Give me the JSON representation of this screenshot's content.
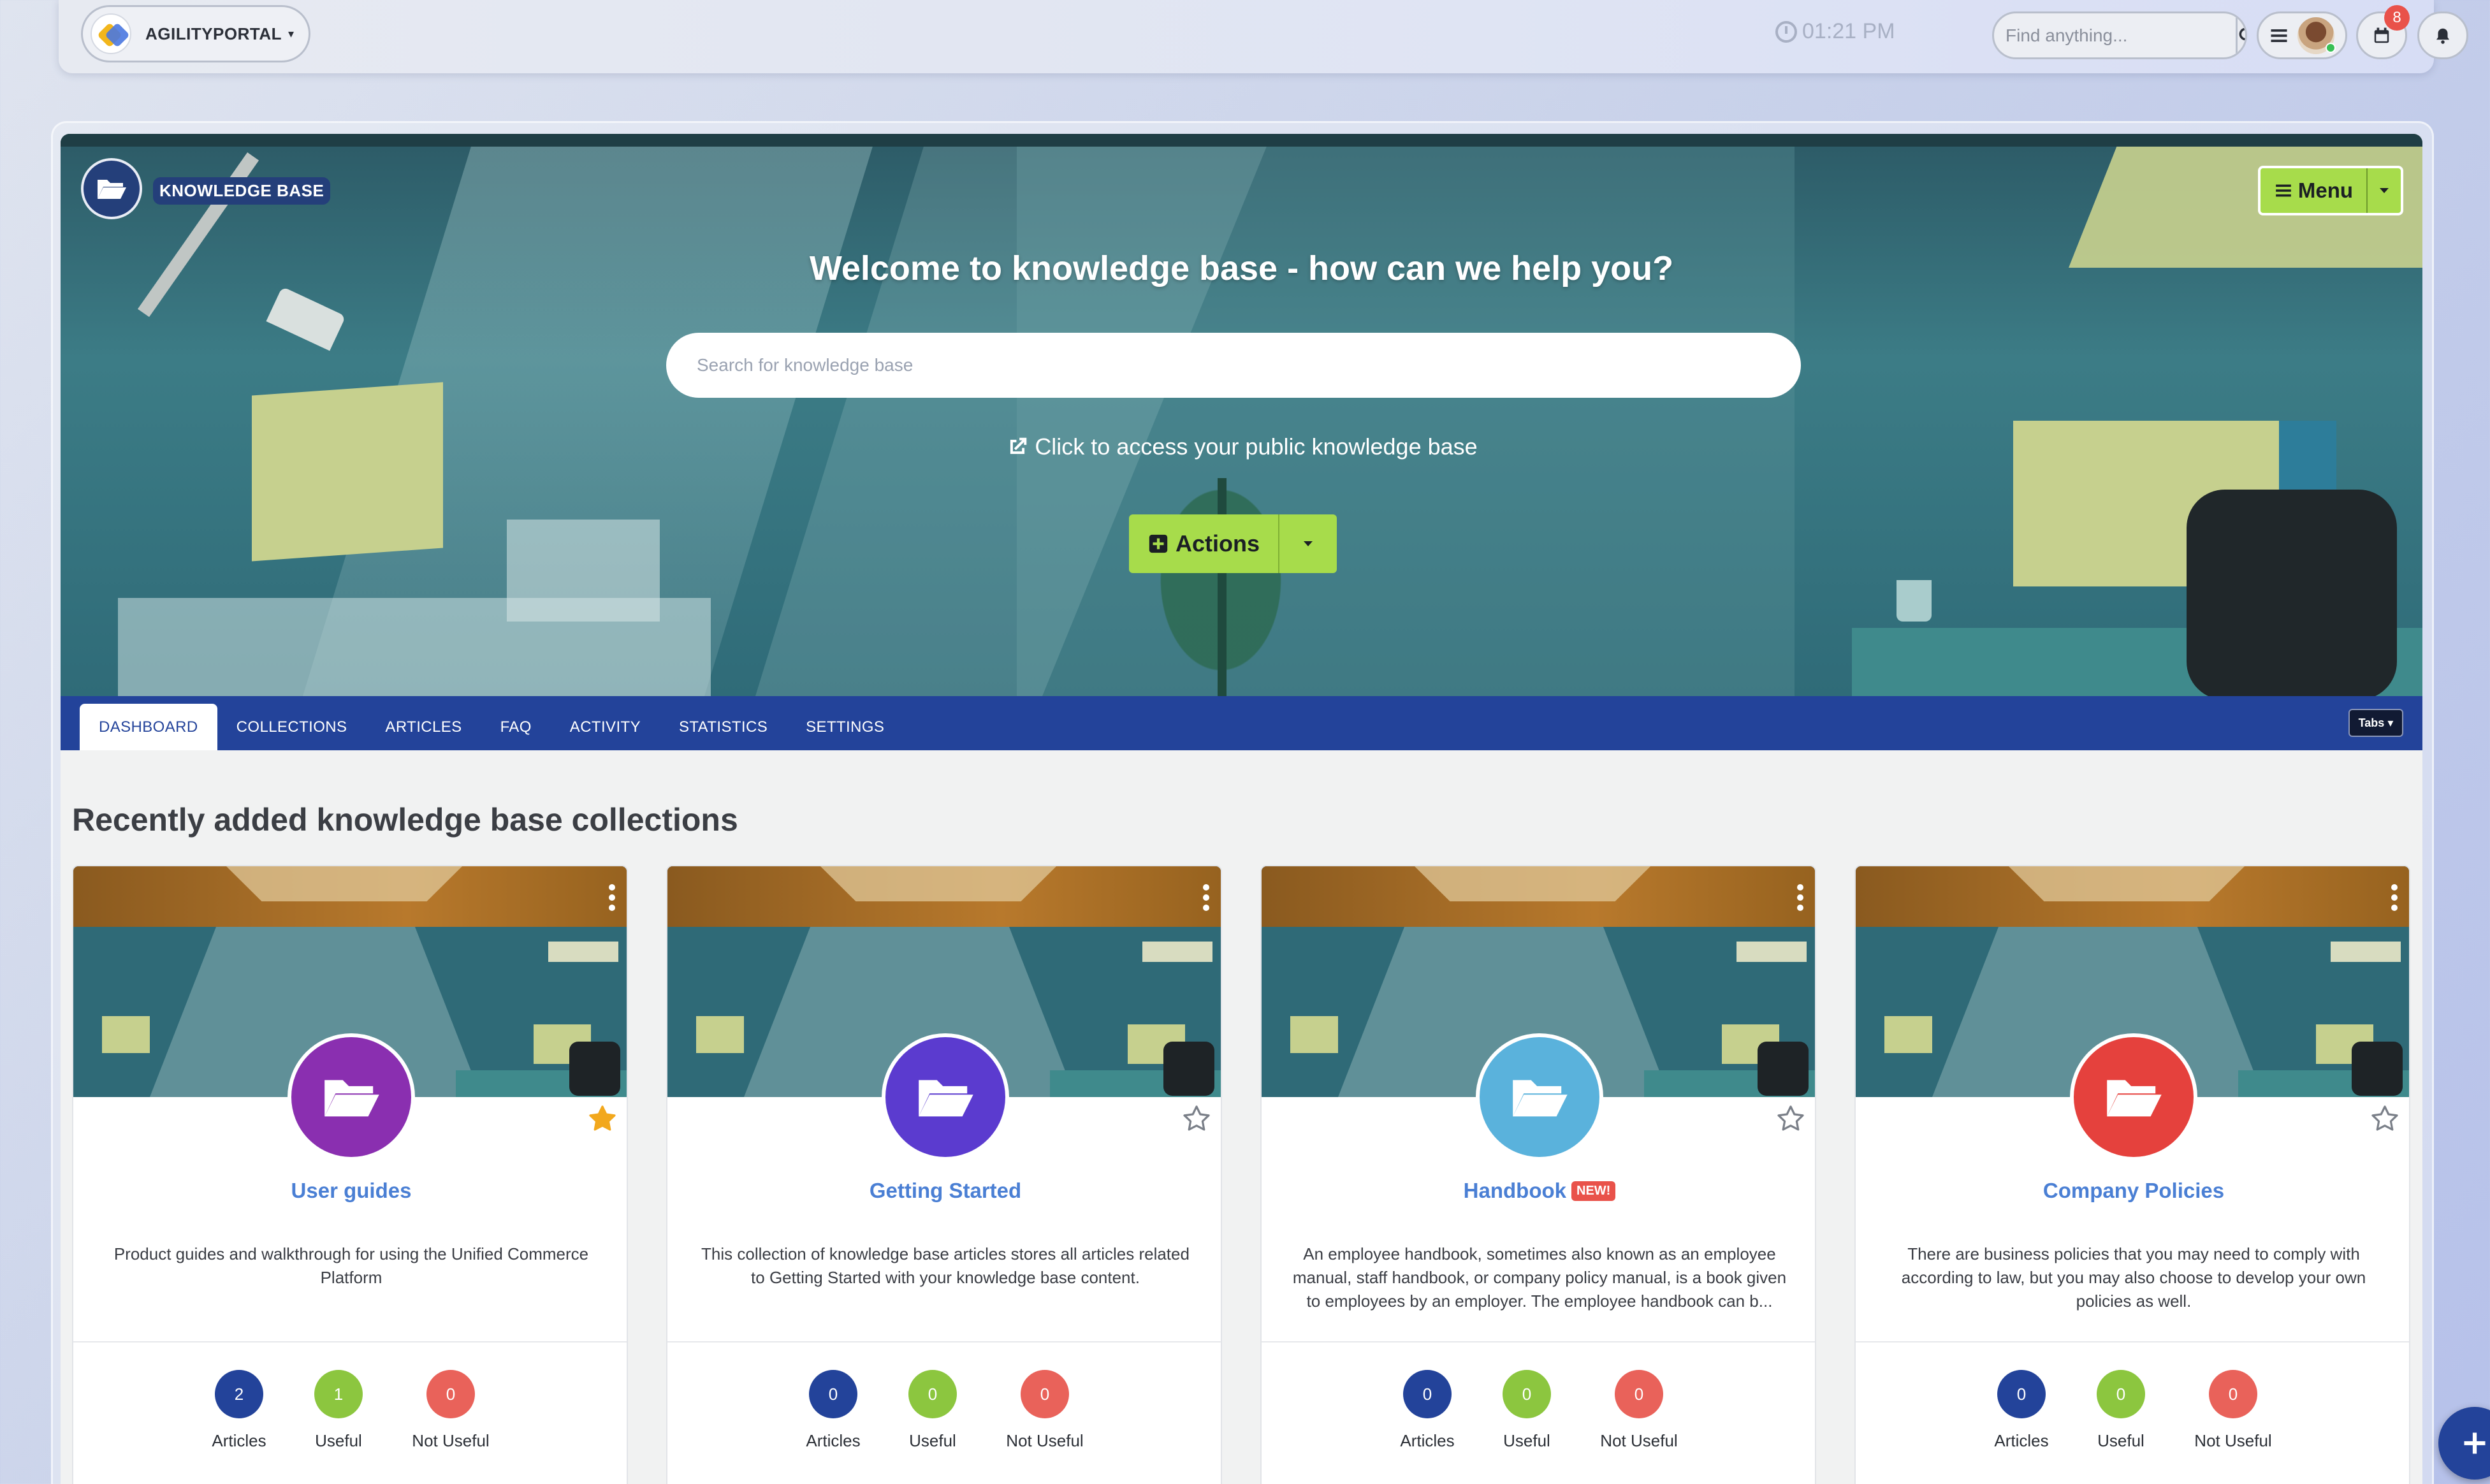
{
  "topbar": {
    "brand": "AGILITYPORTAL",
    "time": "01:21 PM",
    "search_placeholder": "Find anything...",
    "notification_count": "8"
  },
  "hero": {
    "section_label": "KNOWLEDGE BASE",
    "menu_label": "Menu",
    "title": "Welcome to knowledge base - how can we help you?",
    "search_placeholder": "Search for knowledge base",
    "public_link": "Click to access your public knowledge base",
    "actions_label": "Actions"
  },
  "tabs": {
    "items": [
      "DASHBOARD",
      "COLLECTIONS",
      "ARTICLES",
      "FAQ",
      "ACTIVITY",
      "STATISTICS",
      "SETTINGS"
    ],
    "active": "DASHBOARD",
    "toggle_label": "Tabs"
  },
  "content": {
    "section_title": "Recently added knowledge base collections",
    "stat_labels": {
      "articles": "Articles",
      "useful": "Useful",
      "not_useful": "Not Useful"
    },
    "colors": {
      "articles": "#23439a",
      "useful": "#8cc63f",
      "not_useful": "#e9625a"
    },
    "cards": [
      {
        "title": "User guides",
        "description": "Product guides and walkthrough for using the Unified Commerce Platform",
        "icon_color": "#8a2fb0",
        "favorited": true,
        "badge": "",
        "articles": "2",
        "useful": "1",
        "not_useful": "0"
      },
      {
        "title": "Getting Started",
        "description": "This collection of knowledge base articles stores all articles related to Getting Started with your knowledge base content.",
        "icon_color": "#5b3bcf",
        "favorited": false,
        "badge": "",
        "articles": "0",
        "useful": "0",
        "not_useful": "0"
      },
      {
        "title": "Handbook",
        "description": "An employee handbook, sometimes also known as an employee manual, staff handbook, or company policy manual, is a book given to employees by an employer. The employee handbook can b...",
        "icon_color": "#5ab2dc",
        "favorited": false,
        "badge": "NEW!",
        "articles": "0",
        "useful": "0",
        "not_useful": "0"
      },
      {
        "title": "Company Policies",
        "description": "There are business policies that you may need to comply with according to law, but you may also choose to develop your own policies as well.",
        "icon_color": "#e5413d",
        "favorited": false,
        "badge": "",
        "articles": "0",
        "useful": "0",
        "not_useful": "0"
      }
    ]
  }
}
